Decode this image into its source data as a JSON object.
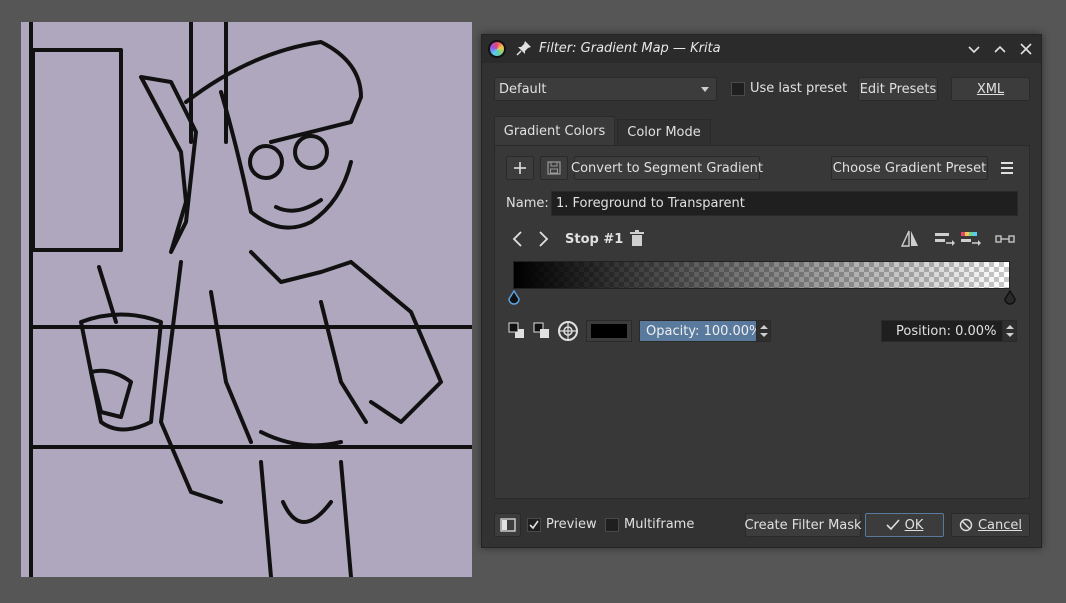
{
  "window": {
    "title": "Filter: Gradient Map — Krita"
  },
  "toolbar": {
    "preset_value": "Default",
    "use_last_preset_label": "Use last preset",
    "edit_presets_label": "Edit Presets",
    "xml_label": "XML"
  },
  "tabs": [
    {
      "label": "Gradient Colors",
      "active": true
    },
    {
      "label": "Color Mode",
      "active": false
    }
  ],
  "gradient": {
    "convert_label": "Convert to Segment Gradient",
    "choose_preset_label": "Choose Gradient Preset",
    "name_label": "Name:",
    "name_value": "1. Foreground to Transparent",
    "stop_label": "Stop #1",
    "stop_color": "#000000",
    "opacity_value": "Opacity: 100.00%",
    "position_value": "Position: 0.00%"
  },
  "footer": {
    "preview_label": "Preview",
    "multiframe_label": "Multiframe",
    "create_mask_label": "Create Filter Mask",
    "ok_label": "OK",
    "cancel_label": "Cancel"
  },
  "colors": {
    "canvas_bg": "#aea7bd",
    "dialog_bg": "#323232",
    "accent": "#59799d"
  }
}
